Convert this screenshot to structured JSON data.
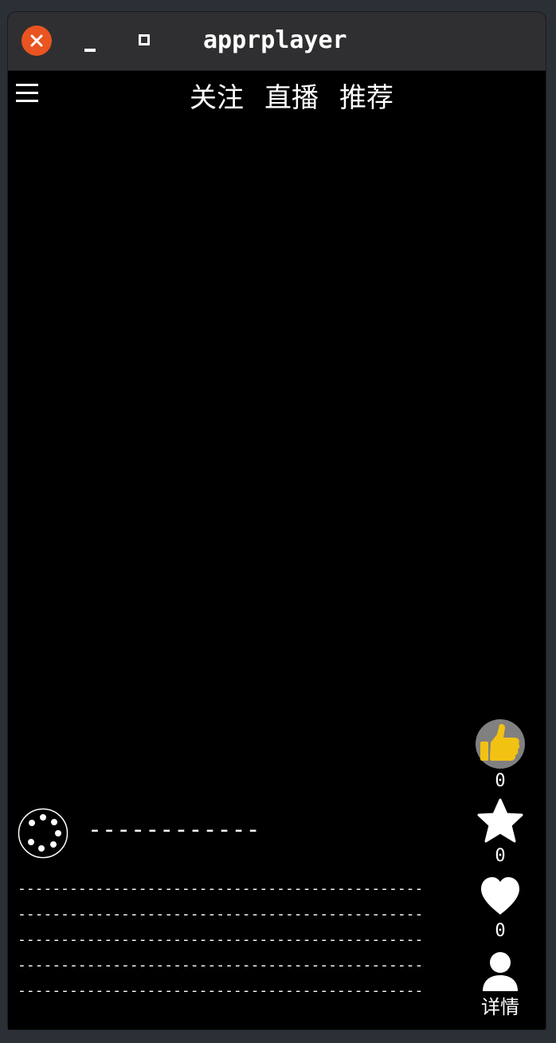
{
  "window": {
    "title": "apprplayer",
    "close_icon": "close-icon",
    "minimize_icon": "minimize-icon",
    "maximize_icon": "maximize-icon"
  },
  "header": {
    "menu_icon": "hamburger-menu-icon",
    "tabs": [
      {
        "label": "关注"
      },
      {
        "label": "直播"
      },
      {
        "label": "推荐"
      }
    ]
  },
  "actions": {
    "like": {
      "icon": "thumbs-up-icon",
      "count": "0"
    },
    "favorite": {
      "icon": "star-icon",
      "count": "0"
    },
    "heart": {
      "icon": "heart-icon",
      "count": "0"
    },
    "detail": {
      "icon": "user-icon",
      "label": "详情"
    }
  },
  "author": {
    "avatar_icon": "loading-spinner-icon",
    "name": "------------"
  },
  "description": {
    "lines": [
      "-----------------------------------------------",
      "-----------------------------------------------",
      "-----------------------------------------------",
      "-----------------------------------------------",
      "-----------------------------------------------"
    ]
  },
  "colors": {
    "titlebar": "#2f2f31",
    "close": "#e95420",
    "background": "#000000",
    "like_accent": "#f2c213",
    "like_bg": "#808080"
  }
}
